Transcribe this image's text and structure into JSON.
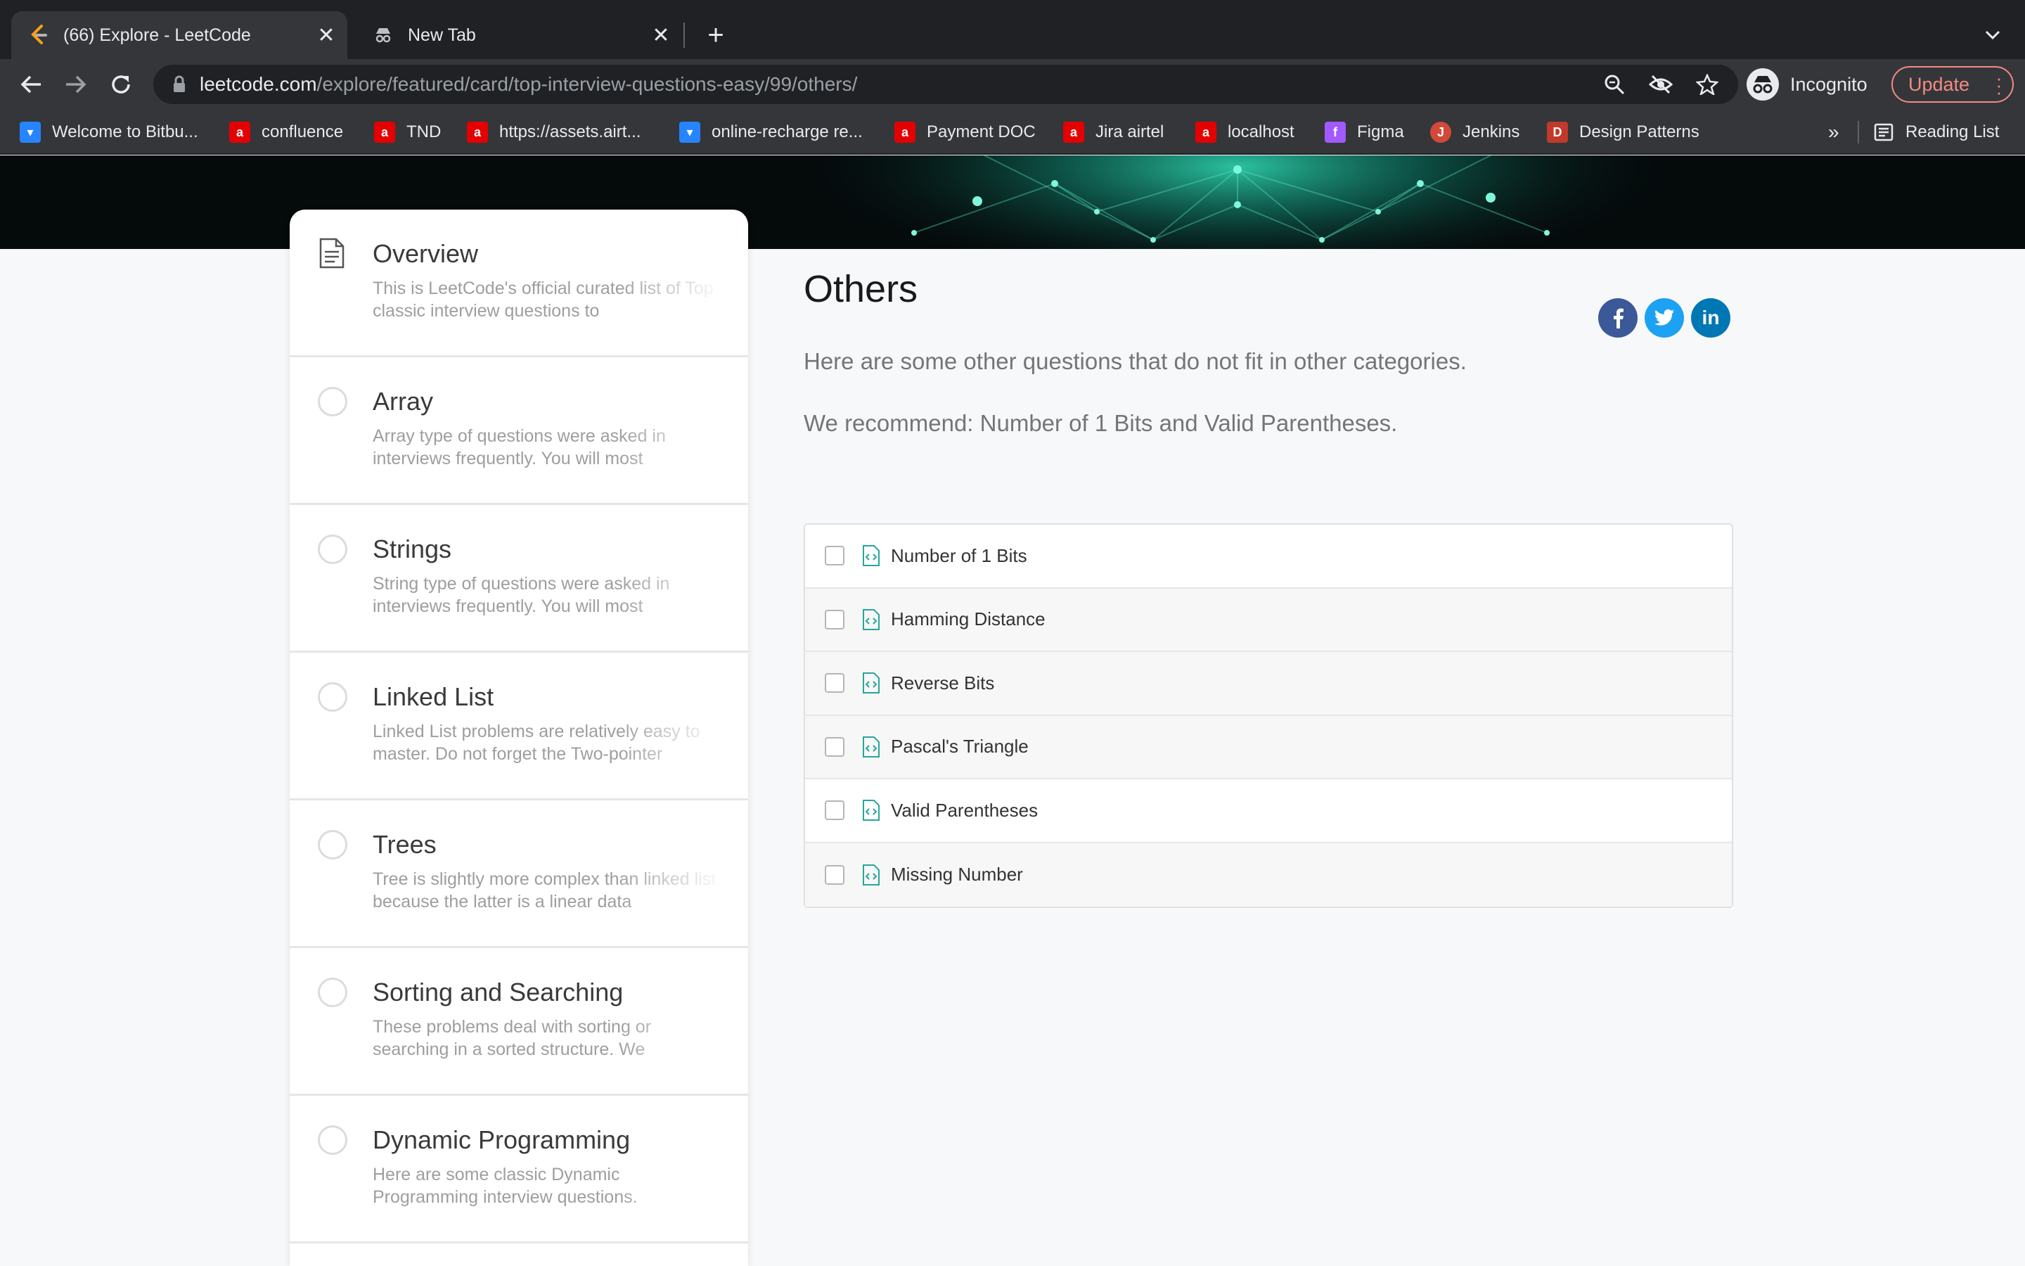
{
  "browser": {
    "tabs": [
      {
        "title": "(66) Explore - LeetCode",
        "active": true
      },
      {
        "title": "New Tab",
        "active": false
      }
    ],
    "url_host": "leetcode.com",
    "url_path": "/explore/featured/card/top-interview-questions-easy/99/others/",
    "profile_label": "Incognito",
    "update_label": "Update",
    "bookmarks": [
      {
        "label": "Welcome to Bitbu...",
        "icon": "bitbucket-icon",
        "color": "#2684ff"
      },
      {
        "label": "confluence",
        "icon": "airtel-icon",
        "color": "#e40000"
      },
      {
        "label": "TND",
        "icon": "airtel-icon",
        "color": "#e40000"
      },
      {
        "label": "https://assets.airt...",
        "icon": "airtel-icon",
        "color": "#e40000"
      },
      {
        "label": "online-recharge re...",
        "icon": "bitbucket-icon",
        "color": "#2684ff"
      },
      {
        "label": "Payment DOC",
        "icon": "airtel-icon",
        "color": "#e40000"
      },
      {
        "label": "Jira airtel",
        "icon": "airtel-icon",
        "color": "#e40000"
      },
      {
        "label": "localhost",
        "icon": "airtel-icon",
        "color": "#e40000"
      },
      {
        "label": "Figma",
        "icon": "figma-icon",
        "color": "#a259ff"
      },
      {
        "label": "Jenkins",
        "icon": "jenkins-icon",
        "color": "#d24939"
      },
      {
        "label": "Design Patterns",
        "icon": "design-patterns-icon",
        "color": "#c0392b"
      }
    ],
    "more_label": "»",
    "reading_list_label": "Reading List"
  },
  "sidebar": {
    "chapters": [
      {
        "title": "Overview",
        "desc": "This is LeetCode's official curated list of Top classic interview questions to",
        "icon": "document-icon"
      },
      {
        "title": "Array",
        "desc": "Array type of questions were asked in interviews frequently. You will most",
        "icon": "progress-circle-icon"
      },
      {
        "title": "Strings",
        "desc": "String type of questions were asked in interviews frequently. You will most",
        "icon": "progress-circle-icon"
      },
      {
        "title": "Linked List",
        "desc": "Linked List problems are relatively easy to master. Do not forget the Two-pointer",
        "icon": "progress-circle-icon"
      },
      {
        "title": "Trees",
        "desc": "Tree is slightly more complex than linked list, because the latter is a linear data",
        "icon": "progress-circle-icon"
      },
      {
        "title": "Sorting and Searching",
        "desc": "These problems deal with sorting or searching in a sorted structure. We",
        "icon": "progress-circle-icon"
      },
      {
        "title": "Dynamic Programming",
        "desc": "Here are some classic Dynamic Programming interview questions.",
        "icon": "progress-circle-icon"
      }
    ]
  },
  "main": {
    "title": "Others",
    "intro": "Here are some other questions that do not fit in other categories.",
    "recommend": "We recommend: Number of 1 Bits and Valid Parentheses.",
    "social": [
      {
        "label": "f",
        "icon": "facebook-icon",
        "color": "#3b5998"
      },
      {
        "label": "t",
        "icon": "twitter-icon",
        "color": "#1da1f2"
      },
      {
        "label": "in",
        "icon": "linkedin-icon",
        "color": "#0077b5"
      }
    ],
    "questions": [
      {
        "name": "Number of 1 Bits"
      },
      {
        "name": "Hamming Distance"
      },
      {
        "name": "Reverse Bits"
      },
      {
        "name": "Pascal's Triangle"
      },
      {
        "name": "Valid Parentheses"
      },
      {
        "name": "Missing Number"
      }
    ]
  },
  "colors": {
    "accent": "#26a69a",
    "chrome_dark": "#202124",
    "chrome_mid": "#35363a"
  }
}
